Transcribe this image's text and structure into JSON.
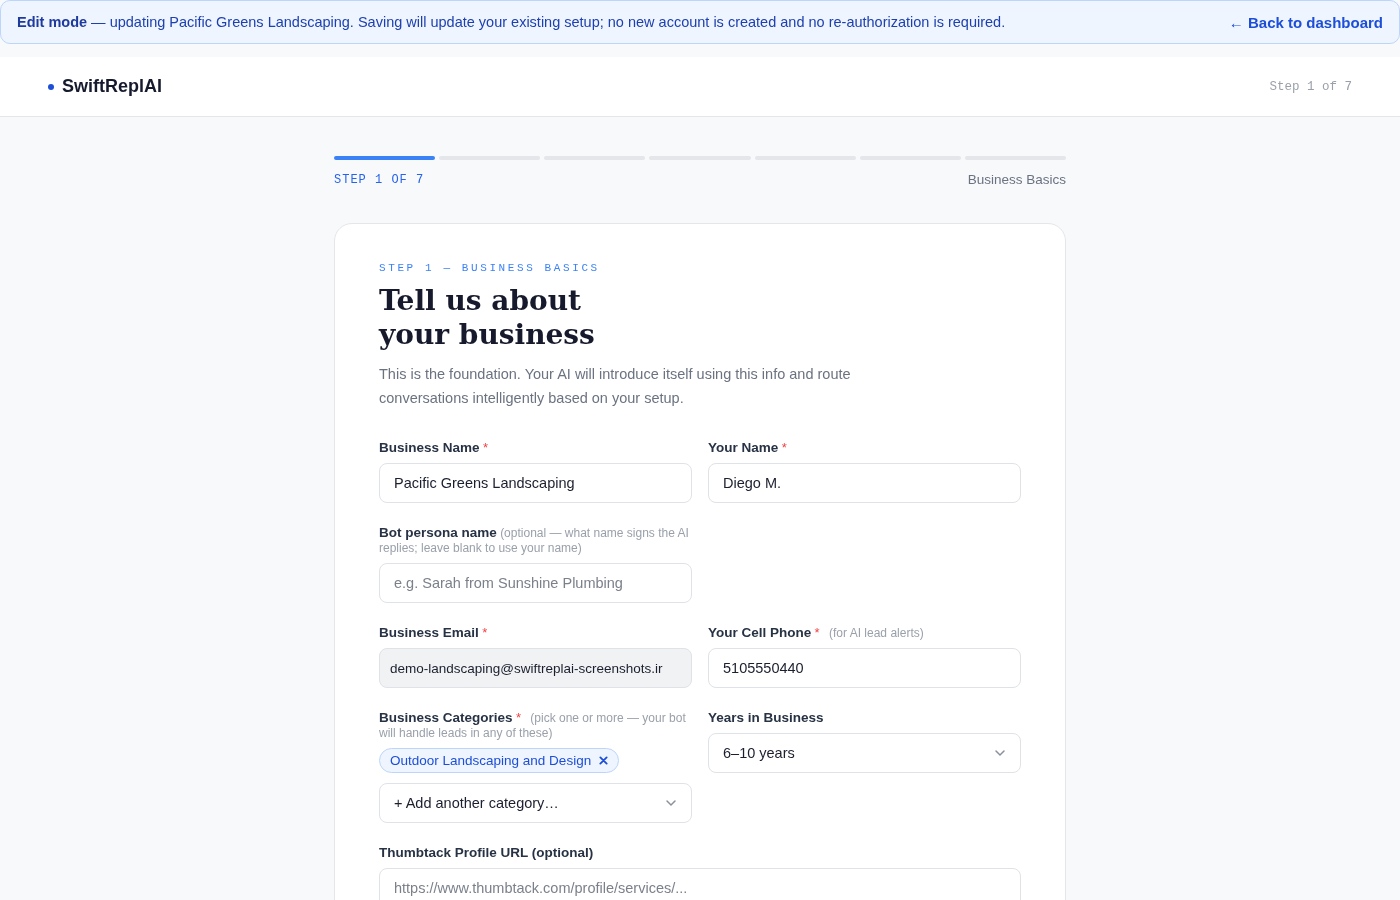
{
  "banner": {
    "lead": "Edit mode",
    "text": "— updating Pacific Greens Landscaping. Saving will update your existing setup; no new account is created and no re-authorization is required.",
    "link": "← Back to dashboard"
  },
  "header": {
    "brand": "SwiftReplAI",
    "step": "Step 1 of 7"
  },
  "progress": {
    "segments": [
      {
        "done": true
      },
      {
        "done": false
      },
      {
        "done": false
      },
      {
        "done": false
      },
      {
        "done": false
      },
      {
        "done": false
      },
      {
        "done": false
      }
    ],
    "label": "STEP 1 OF 7",
    "section": "Business Basics"
  },
  "card": {
    "eyebrow": "STEP 1 — BUSINESS BASICS",
    "title": "Tell us about your business",
    "intro": "This is the foundation. Your AI will introduce itself using this info and route conversations intelligently based on your setup.",
    "fields": [
      {
        "kind": "text",
        "label": "Business Name",
        "required_mark": "*",
        "value": "Pacific Greens Landscaping",
        "disabled": false,
        "full_width": false
      },
      {
        "kind": "text",
        "label": "Your Name",
        "required_mark": "*",
        "value": "Diego M.",
        "disabled": false,
        "full_width": false
      },
      {
        "kind": "text",
        "label": "Bot persona name",
        "hint": "(optional — what name signs the AI replies; leave blank to use your name)",
        "placeholder": "e.g. Sarah from Sunshine Plumbing",
        "disabled": false,
        "full_width": false
      },
      {
        "kind": "empty",
        "full_width": false
      },
      {
        "kind": "text",
        "label": "Business Email",
        "required_mark": "*",
        "value": "demo-landscaping@swiftreplai-screenshots.ir",
        "disabled": true,
        "full_width": false
      },
      {
        "kind": "text",
        "label": "Your Cell Phone",
        "required_mark": "*",
        "hint": "(for AI lead alerts)",
        "value": "5105550440",
        "disabled": false,
        "full_width": false
      },
      {
        "kind": "tags",
        "label": "Business Categories",
        "required_mark": "*",
        "hint": "(pick one or more — your bot will handle leads in any of these)",
        "tags": [
          "Outdoor Landscaping and Design"
        ],
        "value": "+ Add another category…",
        "full_width": false
      },
      {
        "kind": "select",
        "label": "Years in Business",
        "value": "6–10 years",
        "full_width": false
      },
      {
        "kind": "text",
        "label": "Thumbtack Profile URL (optional)",
        "placeholder": "https://www.thumbtack.com/profile/services/...",
        "disabled": false,
        "full_width": true
      }
    ]
  }
}
